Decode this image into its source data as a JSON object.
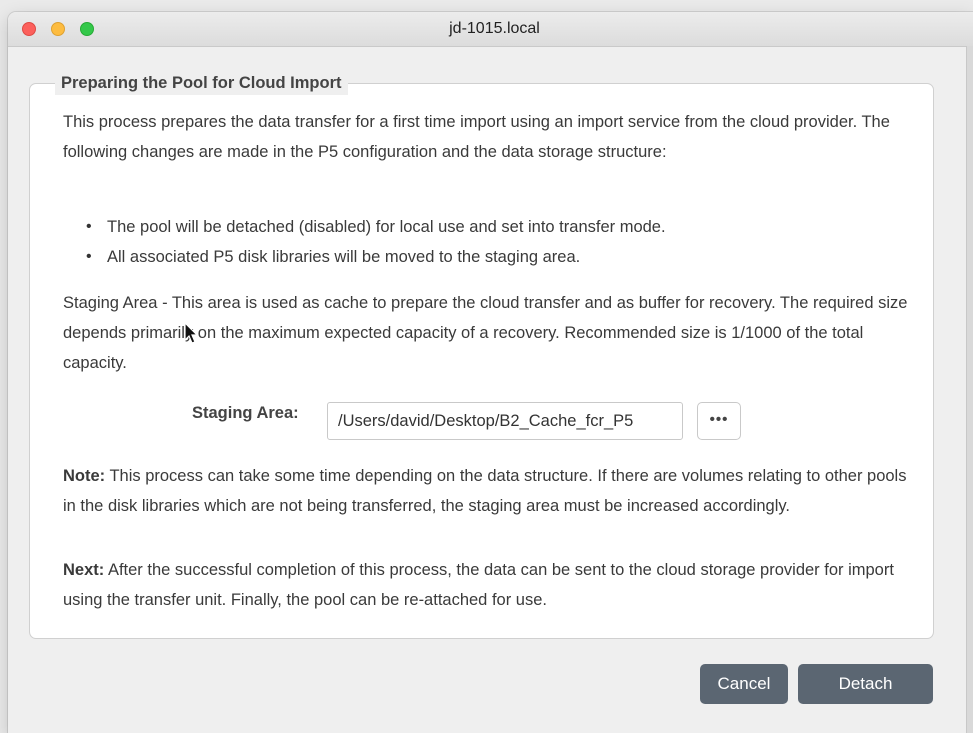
{
  "window": {
    "title": "jd-1015.local"
  },
  "panel": {
    "legend": "Preparing the Pool for Cloud Import",
    "intro": "This process prepares the data transfer for a first time import using an import service from the cloud provider. The following changes are made in the P5 configuration and the data storage structure:",
    "bullets": [
      "The pool will be detached (disabled) for local use and set into transfer mode.",
      "All associated P5 disk libraries will be moved to the staging area."
    ],
    "staging_info": "Staging Area - This area is used as cache to prepare the cloud transfer and as buffer for recovery. The required size depends primarily on the maximum expected capacity of a recovery. Recommended size is 1/1000 of the total capacity.",
    "staging_label": "Staging Area:",
    "staging_value": "/Users/david/Desktop/B2_Cache_fcr_P5",
    "browse_label": "•••",
    "note_label": "Note:",
    "note_text": " This process can take some time depending on the data structure. If there are volumes relating to other pools in the disk libraries which are not being transferred, the staging area must be increased accordingly.",
    "next_label": "Next:",
    "next_text": " After the successful completion of this process, the data can be sent to the cloud storage provider for import using the transfer unit. Finally, the pool can be re-attached for use."
  },
  "buttons": {
    "cancel": "Cancel",
    "detach": "Detach"
  },
  "colors": {
    "button_bg": "#5b6672",
    "close": "#fc605c",
    "minimize": "#fdbc40",
    "maximize": "#34c84a"
  }
}
